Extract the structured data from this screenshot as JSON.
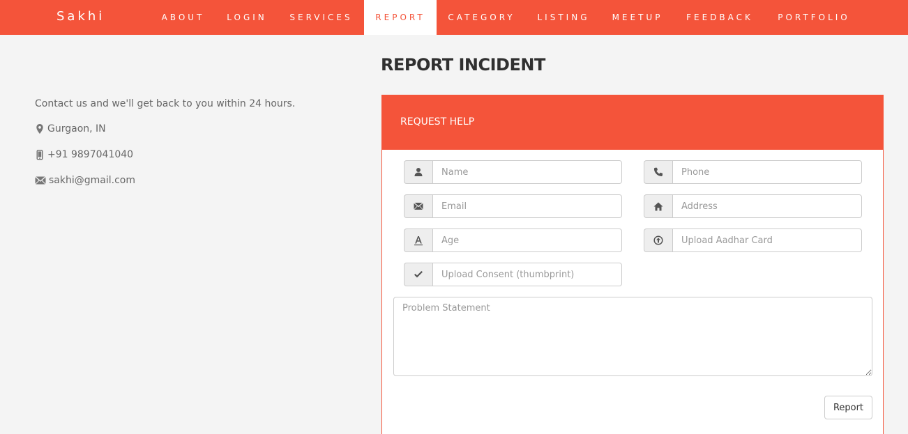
{
  "brand": "Sakhi",
  "nav": {
    "items": [
      {
        "label": "ABOUT"
      },
      {
        "label": "LOGIN"
      },
      {
        "label": "SERVICES"
      },
      {
        "label": "REPORT"
      },
      {
        "label": "CATEGORY"
      },
      {
        "label": "LISTING"
      },
      {
        "label": "MEETUP"
      },
      {
        "label": "FEEDBACK"
      },
      {
        "label": "PORTFOLIO"
      }
    ],
    "active": "REPORT"
  },
  "page": {
    "title": "REPORT INCIDENT"
  },
  "contact": {
    "lead": "Contact us and we'll get back to you within 24 hours.",
    "location": "Gurgaon, IN",
    "phone": "+91 9897041040",
    "email": "sakhi@gmail.com"
  },
  "form": {
    "heading": "REQUEST HELP",
    "name_placeholder": "Name",
    "phone_placeholder": "Phone",
    "email_placeholder": "Email",
    "address_placeholder": "Address",
    "age_placeholder": "Age",
    "aadhar_placeholder": "Upload Aadhar Card",
    "consent_placeholder": "Upload Consent (thumbprint)",
    "problem_placeholder": "Problem Statement",
    "submit_label": "Report"
  },
  "colors": {
    "accent": "#f4543a",
    "background": "#f4f4f4"
  }
}
